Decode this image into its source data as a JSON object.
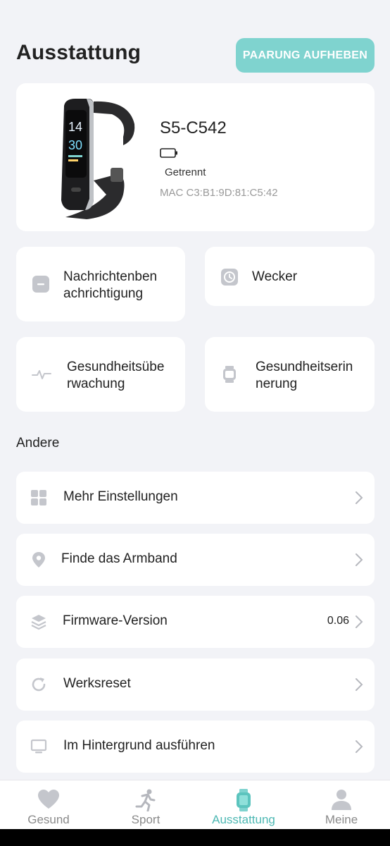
{
  "header": {
    "title": "Ausstattung",
    "unpair_label": "PAARUNG AUFHEBEN"
  },
  "device": {
    "name": "S5-C542",
    "status": "Getrennt",
    "mac": "MAC C3:B1:9D:81:C5:42",
    "screen_time_hour": "14",
    "screen_time_minute": "30"
  },
  "tiles": [
    {
      "label_line1": "Nachrichtenben",
      "label_line2": "achrichtigung",
      "icon": "message-icon"
    },
    {
      "label_line1": "Wecker",
      "label_line2": "",
      "icon": "clock-icon"
    },
    {
      "label_line1": "Gesundheitsübe",
      "label_line2": "rwachung",
      "icon": "heartbeat-icon"
    },
    {
      "label_line1": "Gesundheitserin",
      "label_line2": "nerung",
      "icon": "watch-icon"
    }
  ],
  "section": {
    "other_label": "Andere"
  },
  "rows": [
    {
      "label": "Mehr Einstellungen",
      "icon": "grid-icon",
      "value": ""
    },
    {
      "label": "Finde das Armband",
      "icon": "location-pin-icon",
      "value": ""
    },
    {
      "label": "Firmware-Version",
      "icon": "layers-icon",
      "value": "0.06"
    },
    {
      "label": "Werksreset",
      "icon": "refresh-icon",
      "value": ""
    },
    {
      "label": "Im Hintergrund ausführen",
      "icon": "monitor-icon",
      "value": ""
    }
  ],
  "nav": [
    {
      "label": "Gesund",
      "icon": "heart-icon",
      "active": false
    },
    {
      "label": "Sport",
      "icon": "running-icon",
      "active": false
    },
    {
      "label": "Ausstattung",
      "icon": "band-icon",
      "active": true
    },
    {
      "label": "Meine",
      "icon": "person-icon",
      "active": false
    }
  ],
  "colors": {
    "accent": "#7fd3cf",
    "active_nav": "#4db8b3",
    "background": "#f2f3f7"
  }
}
